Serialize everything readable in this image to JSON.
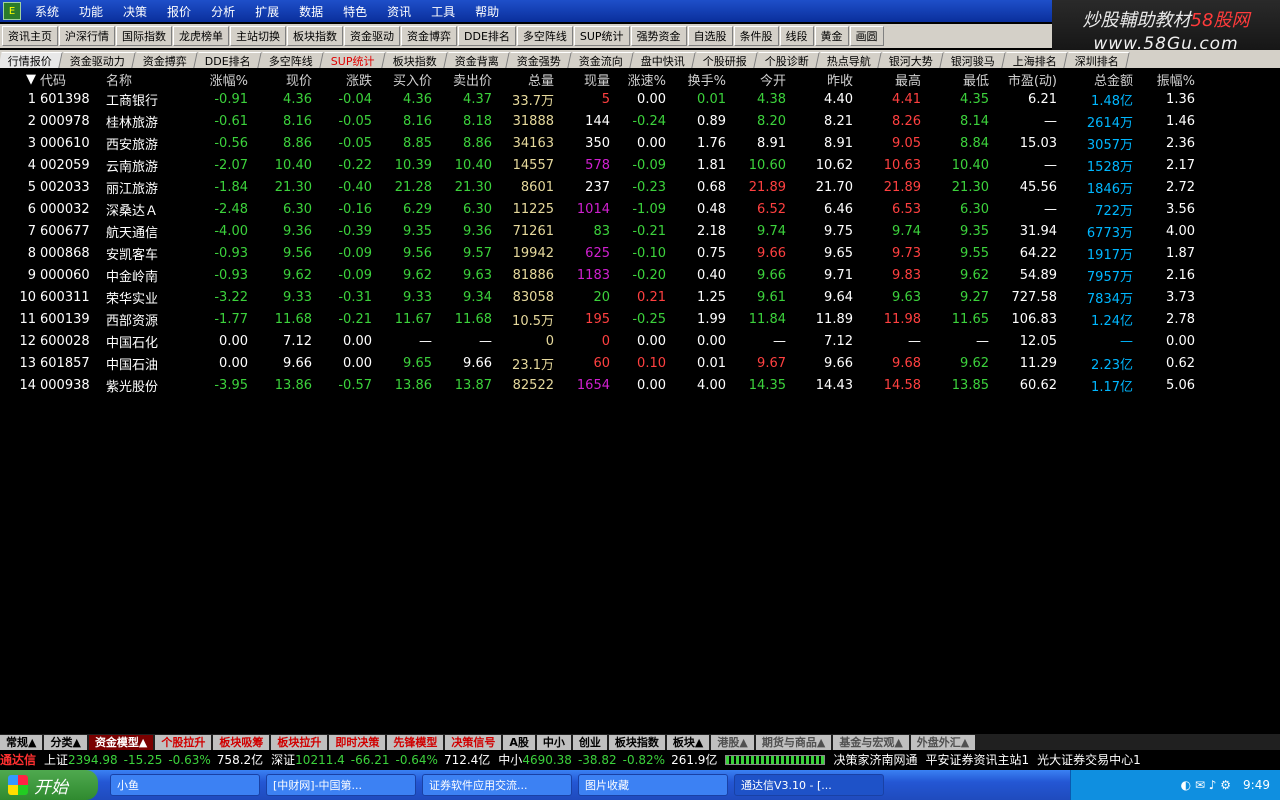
{
  "menubar": {
    "logo": "E",
    "items": [
      "系统",
      "功能",
      "决策",
      "报价",
      "分析",
      "扩展",
      "数据",
      "特色",
      "资讯",
      "工具",
      "帮助"
    ]
  },
  "brand": {
    "line1_a": "炒股輔助教材",
    "line1_b": "58股网",
    "line2": "www.58Gu.com"
  },
  "toolbar": {
    "items": [
      "资讯主页",
      "沪深行情",
      "国际指数",
      "龙虎榜单",
      "主站切换",
      "板块指数",
      "资金驱动",
      "资金博弈",
      "DDE排名",
      "多空阵线",
      "SUP统计",
      "强势资金",
      "自选股",
      "条件股",
      "线段",
      "黄金",
      "画圆"
    ]
  },
  "tabs": {
    "items": [
      "行情报价",
      "资金驱动力",
      "资金搏弈",
      "DDE排名",
      "多空阵线",
      "SUP统计",
      "板块指数",
      "资金背离",
      "资金强势",
      "资金流向",
      "盘中快讯",
      "个股研报",
      "个股诊断",
      "热点导航",
      "银河大势",
      "银河骏马",
      "上海排名",
      "深圳排名"
    ]
  },
  "grid": {
    "headers": [
      "代码",
      "名称",
      "涨幅%",
      "现价",
      "涨跌",
      "买入价",
      "卖出价",
      "总量",
      "现量",
      "涨速%",
      "换手%",
      "今开",
      "昨收",
      "最高",
      "最低",
      "市盈(动)",
      "总金额",
      "振幅%"
    ],
    "rows": [
      [
        "1",
        "601398",
        "工商银行",
        "-0.91",
        "4.36",
        "-0.04",
        "4.36",
        "4.37",
        "33.7万",
        "5",
        "0.00",
        "0.01",
        "4.38",
        "4.40",
        "4.41",
        "4.35",
        "6.21",
        "1.48亿",
        "1.36"
      ],
      [
        "2",
        "000978",
        "桂林旅游",
        "-0.61",
        "8.16",
        "-0.05",
        "8.16",
        "8.18",
        "31888",
        "144",
        "-0.24",
        "0.89",
        "8.20",
        "8.21",
        "8.26",
        "8.14",
        "—",
        "2614万",
        "1.46"
      ],
      [
        "3",
        "000610",
        "西安旅游",
        "-0.56",
        "8.86",
        "-0.05",
        "8.85",
        "8.86",
        "34163",
        "350",
        "0.00",
        "1.76",
        "8.91",
        "8.91",
        "9.05",
        "8.84",
        "15.03",
        "3057万",
        "2.36"
      ],
      [
        "4",
        "002059",
        "云南旅游",
        "-2.07",
        "10.40",
        "-0.22",
        "10.39",
        "10.40",
        "14557",
        "578",
        "-0.09",
        "1.81",
        "10.60",
        "10.62",
        "10.63",
        "10.40",
        "—",
        "1528万",
        "2.17"
      ],
      [
        "5",
        "002033",
        "丽江旅游",
        "-1.84",
        "21.30",
        "-0.40",
        "21.28",
        "21.30",
        "8601",
        "237",
        "-0.23",
        "0.68",
        "21.89",
        "21.70",
        "21.89",
        "21.30",
        "45.56",
        "1846万",
        "2.72"
      ],
      [
        "6",
        "000032",
        "深桑达Ａ",
        "-2.48",
        "6.30",
        "-0.16",
        "6.29",
        "6.30",
        "11225",
        "1014",
        "-1.09",
        "0.48",
        "6.52",
        "6.46",
        "6.53",
        "6.30",
        "—",
        "722万",
        "3.56"
      ],
      [
        "7",
        "600677",
        "航天通信",
        "-4.00",
        "9.36",
        "-0.39",
        "9.35",
        "9.36",
        "71261",
        "83",
        "-0.21",
        "2.18",
        "9.74",
        "9.75",
        "9.74",
        "9.35",
        "31.94",
        "6773万",
        "4.00"
      ],
      [
        "8",
        "000868",
        "安凯客车",
        "-0.93",
        "9.56",
        "-0.09",
        "9.56",
        "9.57",
        "19942",
        "625",
        "-0.10",
        "0.75",
        "9.66",
        "9.65",
        "9.73",
        "9.55",
        "64.22",
        "1917万",
        "1.87"
      ],
      [
        "9",
        "000060",
        "中金岭南",
        "-0.93",
        "9.62",
        "-0.09",
        "9.62",
        "9.63",
        "81886",
        "1183",
        "-0.20",
        "0.40",
        "9.66",
        "9.71",
        "9.83",
        "9.62",
        "54.89",
        "7957万",
        "2.16"
      ],
      [
        "10",
        "600311",
        "荣华实业",
        "-3.22",
        "9.33",
        "-0.31",
        "9.33",
        "9.34",
        "83058",
        "20",
        "0.21",
        "1.25",
        "9.61",
        "9.64",
        "9.63",
        "9.27",
        "727.58",
        "7834万",
        "3.73"
      ],
      [
        "11",
        "600139",
        "西部资源",
        "-1.77",
        "11.68",
        "-0.21",
        "11.67",
        "11.68",
        "10.5万",
        "195",
        "-0.25",
        "1.99",
        "11.84",
        "11.89",
        "11.98",
        "11.65",
        "106.83",
        "1.24亿",
        "2.78"
      ],
      [
        "12",
        "600028",
        "中国石化",
        "0.00",
        "7.12",
        "0.00",
        "—",
        "—",
        "0",
        "0",
        "0.00",
        "0.00",
        "—",
        "7.12",
        "—",
        "—",
        "12.05",
        "—",
        "0.00"
      ],
      [
        "13",
        "601857",
        "中国石油",
        "0.00",
        "9.66",
        "0.00",
        "9.65",
        "9.66",
        "23.1万",
        "60",
        "0.10",
        "0.01",
        "9.67",
        "9.66",
        "9.68",
        "9.62",
        "11.29",
        "2.23亿",
        "0.62"
      ],
      [
        "14",
        "000938",
        "紫光股份",
        "-3.95",
        "13.86",
        "-0.57",
        "13.86",
        "13.87",
        "82522",
        "1654",
        "0.00",
        "4.00",
        "14.35",
        "14.43",
        "14.58",
        "13.85",
        "60.62",
        "1.17亿",
        "5.06"
      ]
    ],
    "colors": [
      [
        "dn",
        "dn",
        "dn",
        "dn",
        "dn",
        "vol",
        "up",
        "eq",
        "dn",
        "dn",
        "eq",
        "up",
        "dn",
        "eq",
        "cy"
      ],
      [
        "dn",
        "dn",
        "dn",
        "dn",
        "dn",
        "vol",
        "eq",
        "dn",
        "eq",
        "dn",
        "eq",
        "up",
        "dn",
        "eq",
        "cy"
      ],
      [
        "dn",
        "dn",
        "dn",
        "dn",
        "dn",
        "vol",
        "eq",
        "eq",
        "eq",
        "eq",
        "eq",
        "up",
        "dn",
        "eq",
        "cy"
      ],
      [
        "dn",
        "dn",
        "dn",
        "dn",
        "dn",
        "vol",
        "mg",
        "dn",
        "eq",
        "dn",
        "eq",
        "up",
        "dn",
        "eq",
        "cy"
      ],
      [
        "dn",
        "dn",
        "dn",
        "dn",
        "dn",
        "vol",
        "eq",
        "dn",
        "eq",
        "up",
        "eq",
        "up",
        "dn",
        "eq",
        "cy"
      ],
      [
        "dn",
        "dn",
        "dn",
        "dn",
        "dn",
        "vol",
        "mg",
        "dn",
        "eq",
        "up",
        "eq",
        "up",
        "dn",
        "eq",
        "cy"
      ],
      [
        "dn",
        "dn",
        "dn",
        "dn",
        "dn",
        "vol",
        "dn",
        "dn",
        "eq",
        "dn",
        "eq",
        "dn",
        "dn",
        "eq",
        "cy"
      ],
      [
        "dn",
        "dn",
        "dn",
        "dn",
        "dn",
        "vol",
        "mg",
        "dn",
        "eq",
        "up",
        "eq",
        "up",
        "dn",
        "eq",
        "cy"
      ],
      [
        "dn",
        "dn",
        "dn",
        "dn",
        "dn",
        "vol",
        "mg",
        "dn",
        "eq",
        "dn",
        "eq",
        "up",
        "dn",
        "eq",
        "cy"
      ],
      [
        "dn",
        "dn",
        "dn",
        "dn",
        "dn",
        "vol",
        "dn",
        "up",
        "eq",
        "dn",
        "eq",
        "dn",
        "dn",
        "eq",
        "cy"
      ],
      [
        "dn",
        "dn",
        "dn",
        "dn",
        "dn",
        "vol",
        "up",
        "dn",
        "eq",
        "dn",
        "eq",
        "up",
        "dn",
        "eq",
        "cy"
      ],
      [
        "eq",
        "eq",
        "eq",
        "eq",
        "eq",
        "vol",
        "up",
        "eq",
        "eq",
        "eq",
        "eq",
        "eq",
        "eq",
        "eq",
        "cy"
      ],
      [
        "eq",
        "eq",
        "eq",
        "dn",
        "eq",
        "vol",
        "up",
        "up",
        "eq",
        "up",
        "eq",
        "up",
        "dn",
        "eq",
        "cy"
      ],
      [
        "dn",
        "dn",
        "dn",
        "dn",
        "dn",
        "vol",
        "mg",
        "eq",
        "eq",
        "dn",
        "eq",
        "up",
        "dn",
        "eq",
        "cy"
      ]
    ]
  },
  "bottomtabs": {
    "items": [
      "常规▲",
      "分类▲",
      "资金模型▲",
      "个股拉升",
      "板块吸筹",
      "板块拉升",
      "即时决策",
      "先锋模型",
      "决策信号",
      "A股",
      "中小",
      "创业",
      "板块指数",
      "板块▲",
      "港股▲",
      "期货与商品▲",
      "基金与宏观▲",
      "外盘外汇▲"
    ]
  },
  "statusbar": {
    "app": "通达信",
    "sh_label": "上证",
    "sh_value": "2394.98",
    "sh_change": "-15.25",
    "sh_pct": "-0.63%",
    "sh_amount": "758.2亿",
    "sz_label": "深证",
    "sz_value": "10211.4",
    "sz_change": "-66.21",
    "sz_pct": "-0.64%",
    "sz_amount": "712.4亿",
    "zx_label": "中小",
    "zx_value": "4690.38",
    "zx_change": "-38.82",
    "zx_pct": "-0.82%",
    "zx_amount": "261.9亿",
    "server": "决策家济南网通",
    "news": "平安证券资讯主站1",
    "trade": "光大证券交易中心1"
  },
  "taskbar": {
    "start": "开始",
    "tasks": [
      "小鱼",
      "[中财网]-中国第...",
      "证券软件应用交流...",
      "图片收藏",
      "通达信V3.10 - [..."
    ],
    "clock": "9:49"
  }
}
